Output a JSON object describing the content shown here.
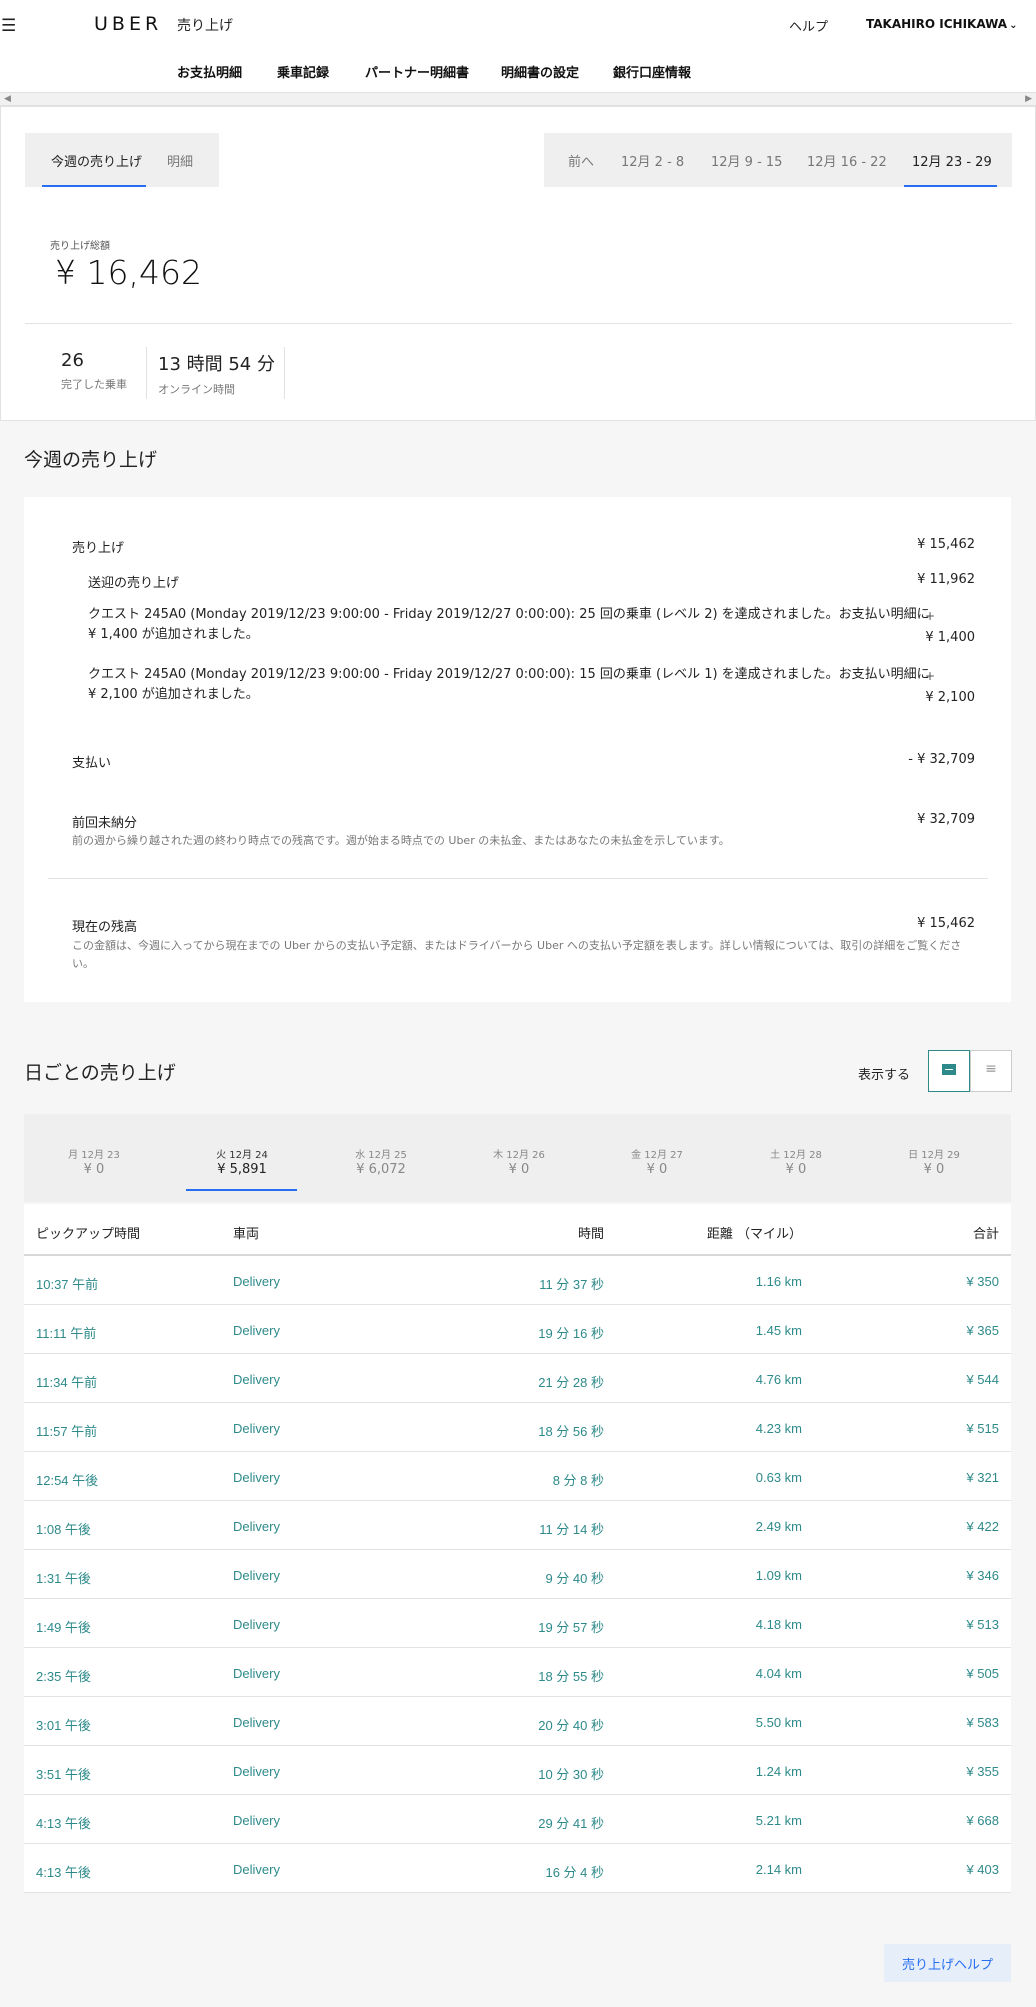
{
  "header": {
    "logo": "UBER",
    "title": "売り上げ",
    "help": "ヘルプ",
    "user": "TAKAHIRO ICHIKAWA",
    "nav": [
      "お支払明細",
      "乗車記録",
      "パートナー明細書",
      "明細書の設定",
      "銀行口座情報"
    ]
  },
  "summary": {
    "tab_earnings": "今週の売り上げ",
    "tab_details": "明細",
    "week_prev": "前へ",
    "weeks": [
      "12月 2 - 8",
      "12月 9 - 15",
      "12月 16 - 22",
      "12月 23 - 29"
    ],
    "total_label": "売り上げ総額",
    "total_value": "¥ 16,462",
    "trips_count": "26",
    "trips_label": "完了した乗車",
    "online_time": "13 時間 54 分",
    "online_label": "オンライン時間"
  },
  "breakdown": {
    "section_title": "今週の売り上げ",
    "earnings_label": "売り上げ",
    "earnings_amount": "¥ 15,462",
    "fares_label": "送迎の売り上げ",
    "fares_amount": "¥ 11,962",
    "quest1_text": "クエスト 245A0 (Monday 2019/12/23 9:00:00 - Friday 2019/12/27 0:00:00): 25 回の乗車 (レベル 2) を達成されました。お支払い明細に ¥ 1,400 が追加されました。",
    "quest1_sign": "+",
    "quest1_amount": "¥ 1,400",
    "quest2_text": "クエスト 245A0 (Monday 2019/12/23 9:00:00 - Friday 2019/12/27 0:00:00): 15 回の乗車 (レベル 1) を達成されました。お支払い明細に ¥ 2,100 が追加されました。",
    "quest2_sign": "+",
    "quest2_amount": "¥ 2,100",
    "payouts_label": "支払い",
    "payouts_amount": "- ¥ 32,709",
    "prev_label": "前回未納分",
    "prev_amount": "¥ 32,709",
    "prev_note": "前の週から繰り越された週の終わり時点での残高です。週が始まる時点での Uber の未払金、またはあなたの未払金を示しています。",
    "balance_label": "現在の残高",
    "balance_amount": "¥ 15,462",
    "balance_note": "この金額は、今週に入ってから現在までの Uber からの支払い予定額、またはドライバーから Uber への支払い予定額を表します。詳しい情報については、取引の詳細をご覧ください。"
  },
  "daily": {
    "section_title": "日ごとの売り上げ",
    "view_label": "表示する",
    "days": [
      {
        "label": "月 12月 23",
        "value": "¥ 0"
      },
      {
        "label": "火 12月 24",
        "value": "¥ 5,891"
      },
      {
        "label": "水 12月 25",
        "value": "¥ 6,072"
      },
      {
        "label": "木 12月 26",
        "value": "¥ 0"
      },
      {
        "label": "金 12月 27",
        "value": "¥ 0"
      },
      {
        "label": "土 12月 28",
        "value": "¥ 0"
      },
      {
        "label": "日 12月 29",
        "value": "¥ 0"
      }
    ],
    "columns": [
      "ピックアップ時間",
      "車両",
      "時間",
      "距離 （マイル）",
      "合計"
    ],
    "rows": [
      [
        "10:37 午前",
        "Delivery",
        "11 分 37 秒",
        "1.16 km",
        "¥ 350"
      ],
      [
        "11:11 午前",
        "Delivery",
        "19 分 16 秒",
        "1.45 km",
        "¥ 365"
      ],
      [
        "11:34 午前",
        "Delivery",
        "21 分 28 秒",
        "4.76 km",
        "¥ 544"
      ],
      [
        "11:57 午前",
        "Delivery",
        "18 分 56 秒",
        "4.23 km",
        "¥ 515"
      ],
      [
        "12:54 午後",
        "Delivery",
        "8 分 8 秒",
        "0.63 km",
        "¥ 321"
      ],
      [
        "1:08 午後",
        "Delivery",
        "11 分 14 秒",
        "2.49 km",
        "¥ 422"
      ],
      [
        "1:31 午後",
        "Delivery",
        "9 分 40 秒",
        "1.09 km",
        "¥ 346"
      ],
      [
        "1:49 午後",
        "Delivery",
        "19 分 57 秒",
        "4.18 km",
        "¥ 513"
      ],
      [
        "2:35 午後",
        "Delivery",
        "18 分 55 秒",
        "4.04 km",
        "¥ 505"
      ],
      [
        "3:01 午後",
        "Delivery",
        "20 分 40 秒",
        "5.50 km",
        "¥ 583"
      ],
      [
        "3:51 午後",
        "Delivery",
        "10 分 30 秒",
        "1.24 km",
        "¥ 355"
      ],
      [
        "4:13 午後",
        "Delivery",
        "29 分 41 秒",
        "5.21 km",
        "¥ 668"
      ],
      [
        "4:13 午後",
        "Delivery",
        "16 分 4 秒",
        "2.14 km",
        "¥ 403"
      ]
    ],
    "help_button": "売り上げヘルプ"
  },
  "colors": {
    "accent_blue": "#276ef1",
    "teal": "#2e8a8a",
    "background": "#f6f6f6"
  },
  "icons": [
    "menu-icon",
    "chevron-down-icon",
    "scroll-left-icon",
    "scroll-right-icon",
    "chart-view-icon",
    "list-view-icon"
  ]
}
